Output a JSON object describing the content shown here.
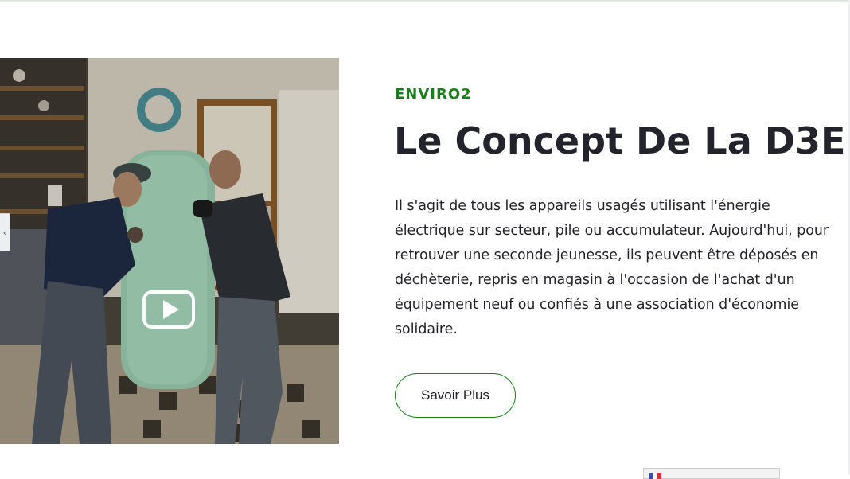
{
  "section": {
    "eyebrow": "ENVIRO2",
    "title": "Le Concept De La D3E",
    "description": "Il s'agit de tous les appareils usagés utilisant l'énergie électrique sur secteur, pile ou accumulateur. Aujourd'hui, pour retrouver une seconde jeunesse, ils peuvent être déposés en déchèterie, repris en magasin à l'occasion de l'achat d'un équipement neuf ou confiés à une association d'économie solidaire.",
    "cta_label": "Savoir Plus"
  },
  "video": {
    "play_icon": "play-icon",
    "thumbnail_subject": "two movers carrying a mint-green refrigerator in a kitchen"
  },
  "side_tab": {
    "arrow_icon": "chevron-left-icon",
    "glyph": "‹"
  },
  "colors": {
    "accent": "#1a7f1a",
    "text": "#23242b",
    "background": "#ffffff"
  }
}
